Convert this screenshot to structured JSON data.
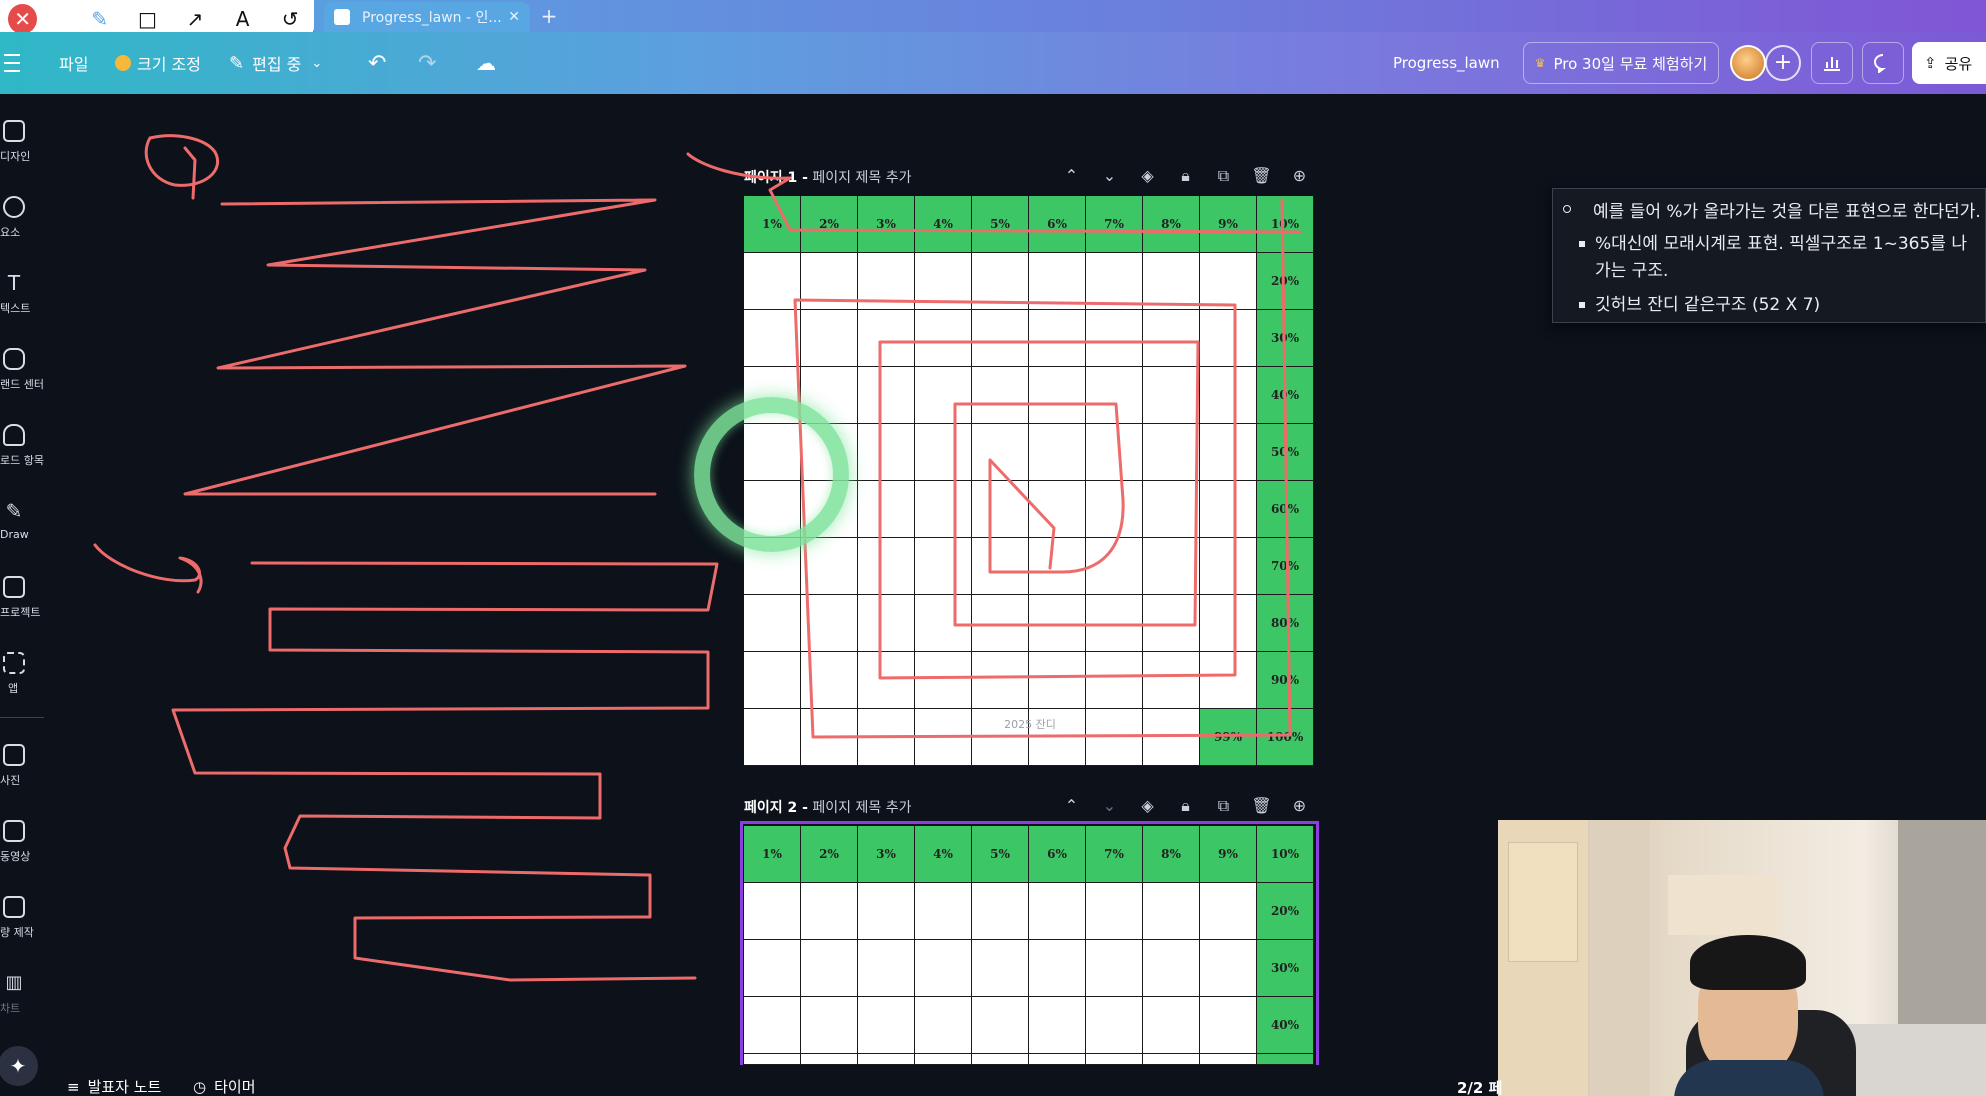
{
  "draw_toolbar": {
    "close_icon": "✕",
    "tools": [
      {
        "name": "pen-tool-icon",
        "glyph": "✎"
      },
      {
        "name": "rectangle-tool-icon",
        "glyph": "□"
      },
      {
        "name": "arrow-tool-icon",
        "glyph": "↗"
      },
      {
        "name": "text-tool-icon",
        "glyph": "A"
      },
      {
        "name": "undo-tool-icon",
        "glyph": "↺"
      }
    ]
  },
  "browser": {
    "tab_title": "Progress_lawn - 인...",
    "tab_close": "✕",
    "new_tab": "+"
  },
  "header": {
    "file": "파일",
    "resize": "크기 조정",
    "editing": "편집 중",
    "doc_title": "Progress_lawn",
    "pro_trial": "Pro 30일 무료 체험하기",
    "share": "공유"
  },
  "sidebar": {
    "items": [
      {
        "label": "디자인",
        "icon": "design-icon"
      },
      {
        "label": "요소",
        "icon": "elements-icon"
      },
      {
        "label": "텍스트",
        "icon": "text-icon"
      },
      {
        "label": "랜드 센터",
        "icon": "brand-center-icon"
      },
      {
        "label": "로드 항목",
        "icon": "upload-icon"
      },
      {
        "label": "Draw",
        "icon": "draw-icon"
      },
      {
        "label": "프로젝트",
        "icon": "projects-icon"
      },
      {
        "label": "앱",
        "icon": "apps-icon"
      },
      {
        "label": "사진",
        "icon": "photos-icon"
      },
      {
        "label": "동영상",
        "icon": "videos-icon"
      },
      {
        "label": "량 제작",
        "icon": "bulk-create-icon"
      },
      {
        "label": "차트",
        "icon": "charts-icon"
      }
    ]
  },
  "pages": [
    {
      "title_bold": "페이지 1 -",
      "title_rest": " 페이지 제목 추가",
      "top_row": [
        "1%",
        "2%",
        "3%",
        "4%",
        "5%",
        "6%",
        "7%",
        "8%",
        "9%",
        "10%"
      ],
      "right_col": [
        "20%",
        "30%",
        "40%",
        "50%",
        "60%",
        "70%",
        "80%",
        "90%"
      ],
      "bottom_right": [
        "99%",
        "100%"
      ],
      "footer": "2025 잔디"
    },
    {
      "title_bold": "페이지 2 -",
      "title_rest": " 페이지 제목 추가",
      "top_row": [
        "1%",
        "2%",
        "3%",
        "4%",
        "5%",
        "6%",
        "7%",
        "8%",
        "9%",
        "10%"
      ],
      "right_col": [
        "20%",
        "30%",
        "40%"
      ]
    }
  ],
  "notes": {
    "line1": "예를 들어 %가 올라가는 것을 다른 표현으로 한다던가.",
    "line2a": "%대신에 모래시계로 표현. 픽셀구조로 1~365를 나",
    "line2b": "가는 구조.",
    "line3": "깃허브 잔디 같은구조 (52 X 7)"
  },
  "bottom_bar": {
    "speaker_notes": "발표자 노트",
    "timer": "타이머",
    "page_indicator": "2/2 페"
  },
  "colors": {
    "grid_green": "#3dc666",
    "annotation_red": "#ee6b6b",
    "laser_green": "#7de39a"
  }
}
